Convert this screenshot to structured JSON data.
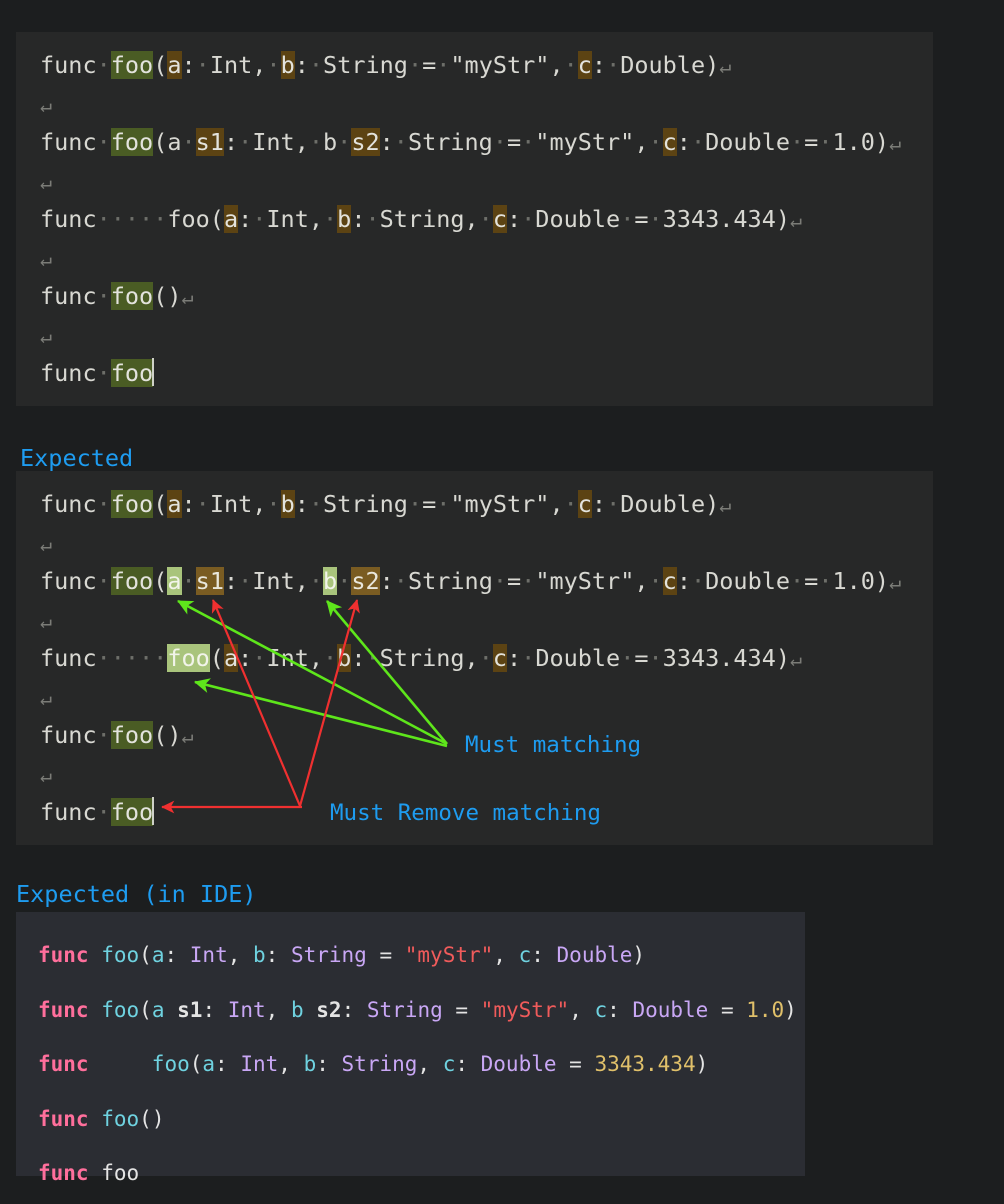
{
  "colors": {
    "page_bg": "#1c1e1f",
    "code_bg": "#272828",
    "ide_bg": "#2b2d33",
    "caption_blue": "#1e9cf0",
    "highlight_dark_green": "#4a5c24",
    "highlight_light_green": "#a9c47c",
    "highlight_dark_brown": "#5c4313",
    "highlight_light_brown": "#7a5c22",
    "arrow_green": "#5ee61b",
    "arrow_red": "#f03030",
    "keyword_pink": "#ff6f9c",
    "function_cyan": "#6fd2e0",
    "type_purple": "#c9a7f5",
    "string_red": "#f05b5b",
    "number_gold": "#e0c06a"
  },
  "block_actual": {
    "lines": [
      {
        "tokens": [
          {
            "t": "func",
            "s": "plain"
          },
          {
            "t": "·",
            "s": "ws"
          },
          {
            "t": "foo",
            "s": "hl-green"
          },
          {
            "t": "(",
            "s": "plain"
          },
          {
            "t": "a",
            "s": "hl-brown"
          },
          {
            "t": ":",
            "s": "plain"
          },
          {
            "t": "·",
            "s": "ws"
          },
          {
            "t": "Int,",
            "s": "plain"
          },
          {
            "t": "·",
            "s": "ws"
          },
          {
            "t": "b",
            "s": "hl-brown"
          },
          {
            "t": ":",
            "s": "plain"
          },
          {
            "t": "·",
            "s": "ws"
          },
          {
            "t": "String",
            "s": "plain"
          },
          {
            "t": "·",
            "s": "ws"
          },
          {
            "t": "=",
            "s": "plain"
          },
          {
            "t": "·",
            "s": "ws"
          },
          {
            "t": "\"myStr\",",
            "s": "plain"
          },
          {
            "t": "·",
            "s": "ws"
          },
          {
            "t": "c",
            "s": "hl-brown"
          },
          {
            "t": ":",
            "s": "plain"
          },
          {
            "t": "·",
            "s": "ws"
          },
          {
            "t": "Double)",
            "s": "plain"
          },
          {
            "t": "↵",
            "s": "cr"
          }
        ]
      },
      {
        "tokens": [
          {
            "t": "↵",
            "s": "cr"
          }
        ]
      },
      {
        "tokens": [
          {
            "t": "func",
            "s": "plain"
          },
          {
            "t": "·",
            "s": "ws"
          },
          {
            "t": "foo",
            "s": "hl-green"
          },
          {
            "t": "(a",
            "s": "plain"
          },
          {
            "t": "·",
            "s": "ws"
          },
          {
            "t": "s1",
            "s": "hl-brown"
          },
          {
            "t": ":",
            "s": "plain"
          },
          {
            "t": "·",
            "s": "ws"
          },
          {
            "t": "Int,",
            "s": "plain"
          },
          {
            "t": "·",
            "s": "ws"
          },
          {
            "t": "b",
            "s": "plain"
          },
          {
            "t": "·",
            "s": "ws"
          },
          {
            "t": "s2",
            "s": "hl-brown"
          },
          {
            "t": ":",
            "s": "plain"
          },
          {
            "t": "·",
            "s": "ws"
          },
          {
            "t": "String",
            "s": "plain"
          },
          {
            "t": "·",
            "s": "ws"
          },
          {
            "t": "=",
            "s": "plain"
          },
          {
            "t": "·",
            "s": "ws"
          },
          {
            "t": "\"myStr\",",
            "s": "plain"
          },
          {
            "t": "·",
            "s": "ws"
          },
          {
            "t": "c",
            "s": "hl-brown"
          },
          {
            "t": ":",
            "s": "plain"
          },
          {
            "t": "·",
            "s": "ws"
          },
          {
            "t": "Double",
            "s": "plain"
          },
          {
            "t": "·",
            "s": "ws"
          },
          {
            "t": "=",
            "s": "plain"
          },
          {
            "t": "·",
            "s": "ws"
          },
          {
            "t": "1.0)",
            "s": "plain"
          },
          {
            "t": "↵",
            "s": "cr"
          }
        ]
      },
      {
        "tokens": [
          {
            "t": "↵",
            "s": "cr"
          }
        ]
      },
      {
        "tokens": [
          {
            "t": "func",
            "s": "plain"
          },
          {
            "t": "·····",
            "s": "ws"
          },
          {
            "t": "foo(",
            "s": "plain"
          },
          {
            "t": "a",
            "s": "hl-brown"
          },
          {
            "t": ":",
            "s": "plain"
          },
          {
            "t": "·",
            "s": "ws"
          },
          {
            "t": "Int,",
            "s": "plain"
          },
          {
            "t": "·",
            "s": "ws"
          },
          {
            "t": "b",
            "s": "hl-brown"
          },
          {
            "t": ":",
            "s": "plain"
          },
          {
            "t": "·",
            "s": "ws"
          },
          {
            "t": "String,",
            "s": "plain"
          },
          {
            "t": "·",
            "s": "ws"
          },
          {
            "t": "c",
            "s": "hl-brown"
          },
          {
            "t": ":",
            "s": "plain"
          },
          {
            "t": "·",
            "s": "ws"
          },
          {
            "t": "Double",
            "s": "plain"
          },
          {
            "t": "·",
            "s": "ws"
          },
          {
            "t": "=",
            "s": "plain"
          },
          {
            "t": "·",
            "s": "ws"
          },
          {
            "t": "3343.434)",
            "s": "plain"
          },
          {
            "t": "↵",
            "s": "cr"
          }
        ]
      },
      {
        "tokens": [
          {
            "t": "↵",
            "s": "cr"
          }
        ]
      },
      {
        "tokens": [
          {
            "t": "func",
            "s": "plain"
          },
          {
            "t": "·",
            "s": "ws"
          },
          {
            "t": "foo",
            "s": "hl-green"
          },
          {
            "t": "()",
            "s": "plain"
          },
          {
            "t": "↵",
            "s": "cr"
          }
        ]
      },
      {
        "tokens": [
          {
            "t": "↵",
            "s": "cr"
          }
        ]
      },
      {
        "tokens": [
          {
            "t": "func",
            "s": "plain"
          },
          {
            "t": "·",
            "s": "ws"
          },
          {
            "t": "foo",
            "s": "hl-green"
          },
          {
            "t": "",
            "s": "caret"
          }
        ]
      }
    ]
  },
  "caption_expected": "Expected",
  "block_expected": {
    "lines": [
      {
        "tokens": [
          {
            "t": "func",
            "s": "plain"
          },
          {
            "t": "·",
            "s": "ws"
          },
          {
            "t": "foo",
            "s": "hl-green"
          },
          {
            "t": "(",
            "s": "plain"
          },
          {
            "t": "a",
            "s": "hl-brown"
          },
          {
            "t": ":",
            "s": "plain"
          },
          {
            "t": "·",
            "s": "ws"
          },
          {
            "t": "Int,",
            "s": "plain"
          },
          {
            "t": "·",
            "s": "ws"
          },
          {
            "t": "b",
            "s": "hl-brown"
          },
          {
            "t": ":",
            "s": "plain"
          },
          {
            "t": "·",
            "s": "ws"
          },
          {
            "t": "String",
            "s": "plain"
          },
          {
            "t": "·",
            "s": "ws"
          },
          {
            "t": "=",
            "s": "plain"
          },
          {
            "t": "·",
            "s": "ws"
          },
          {
            "t": "\"myStr\",",
            "s": "plain"
          },
          {
            "t": "·",
            "s": "ws"
          },
          {
            "t": "c",
            "s": "hl-brown"
          },
          {
            "t": ":",
            "s": "plain"
          },
          {
            "t": "·",
            "s": "ws"
          },
          {
            "t": "Double)",
            "s": "plain"
          },
          {
            "t": "↵",
            "s": "cr"
          }
        ]
      },
      {
        "tokens": [
          {
            "t": "↵",
            "s": "cr"
          }
        ]
      },
      {
        "tokens": [
          {
            "t": "func",
            "s": "plain"
          },
          {
            "t": "·",
            "s": "ws"
          },
          {
            "t": "foo",
            "s": "hl-green"
          },
          {
            "t": "(",
            "s": "plain"
          },
          {
            "t": "a",
            "s": "hl-lgreen"
          },
          {
            "t": "·",
            "s": "ws"
          },
          {
            "t": "s1",
            "s": "hl-lbrown"
          },
          {
            "t": ":",
            "s": "plain"
          },
          {
            "t": "·",
            "s": "ws"
          },
          {
            "t": "Int,",
            "s": "plain"
          },
          {
            "t": "·",
            "s": "ws"
          },
          {
            "t": "b",
            "s": "hl-lgreen"
          },
          {
            "t": "·",
            "s": "ws"
          },
          {
            "t": "s2",
            "s": "hl-lbrown"
          },
          {
            "t": ":",
            "s": "plain"
          },
          {
            "t": "·",
            "s": "ws"
          },
          {
            "t": "String",
            "s": "plain"
          },
          {
            "t": "·",
            "s": "ws"
          },
          {
            "t": "=",
            "s": "plain"
          },
          {
            "t": "·",
            "s": "ws"
          },
          {
            "t": "\"myStr\",",
            "s": "plain"
          },
          {
            "t": "·",
            "s": "ws"
          },
          {
            "t": "c",
            "s": "hl-brown"
          },
          {
            "t": ":",
            "s": "plain"
          },
          {
            "t": "·",
            "s": "ws"
          },
          {
            "t": "Double",
            "s": "plain"
          },
          {
            "t": "·",
            "s": "ws"
          },
          {
            "t": "=",
            "s": "plain"
          },
          {
            "t": "·",
            "s": "ws"
          },
          {
            "t": "1.0)",
            "s": "plain"
          },
          {
            "t": "↵",
            "s": "cr"
          }
        ]
      },
      {
        "tokens": [
          {
            "t": "↵",
            "s": "cr"
          }
        ]
      },
      {
        "tokens": [
          {
            "t": "func",
            "s": "plain"
          },
          {
            "t": "·····",
            "s": "ws"
          },
          {
            "t": "foo",
            "s": "hl-lgreen"
          },
          {
            "t": "(",
            "s": "plain"
          },
          {
            "t": "a",
            "s": "hl-brown"
          },
          {
            "t": ":",
            "s": "plain"
          },
          {
            "t": "·",
            "s": "ws"
          },
          {
            "t": "Int,",
            "s": "plain"
          },
          {
            "t": "·",
            "s": "ws"
          },
          {
            "t": "b",
            "s": "hl-brown"
          },
          {
            "t": ":",
            "s": "plain"
          },
          {
            "t": "·",
            "s": "ws"
          },
          {
            "t": "String,",
            "s": "plain"
          },
          {
            "t": "·",
            "s": "ws"
          },
          {
            "t": "c",
            "s": "hl-brown"
          },
          {
            "t": ":",
            "s": "plain"
          },
          {
            "t": "·",
            "s": "ws"
          },
          {
            "t": "Double",
            "s": "plain"
          },
          {
            "t": "·",
            "s": "ws"
          },
          {
            "t": "=",
            "s": "plain"
          },
          {
            "t": "·",
            "s": "ws"
          },
          {
            "t": "3343.434)",
            "s": "plain"
          },
          {
            "t": "↵",
            "s": "cr"
          }
        ]
      },
      {
        "tokens": [
          {
            "t": "↵",
            "s": "cr"
          }
        ]
      },
      {
        "tokens": [
          {
            "t": "func",
            "s": "plain"
          },
          {
            "t": "·",
            "s": "ws"
          },
          {
            "t": "foo",
            "s": "hl-green"
          },
          {
            "t": "()",
            "s": "plain"
          },
          {
            "t": "↵",
            "s": "cr"
          }
        ]
      },
      {
        "tokens": [
          {
            "t": "↵",
            "s": "cr"
          }
        ]
      },
      {
        "tokens": [
          {
            "t": "func",
            "s": "plain"
          },
          {
            "t": "·",
            "s": "ws"
          },
          {
            "t": "foo",
            "s": "hl-green"
          },
          {
            "t": "",
            "s": "caret"
          }
        ]
      }
    ]
  },
  "annotations": {
    "must_matching": "Must matching",
    "must_remove_matching": "Must Remove matching"
  },
  "caption_expected_ide": "Expected (in IDE)",
  "block_ide": {
    "lines": [
      {
        "tokens": [
          {
            "t": "func",
            "s": "kw"
          },
          {
            "t": " ",
            "s": "pln"
          },
          {
            "t": "foo",
            "s": "fn"
          },
          {
            "t": "(",
            "s": "op"
          },
          {
            "t": "a",
            "s": "lbl"
          },
          {
            "t": ": ",
            "s": "op"
          },
          {
            "t": "Int",
            "s": "typ"
          },
          {
            "t": ", ",
            "s": "op"
          },
          {
            "t": "b",
            "s": "lbl"
          },
          {
            "t": ": ",
            "s": "op"
          },
          {
            "t": "String",
            "s": "typ"
          },
          {
            "t": " = ",
            "s": "op"
          },
          {
            "t": "\"myStr\"",
            "s": "str"
          },
          {
            "t": ", ",
            "s": "op"
          },
          {
            "t": "c",
            "s": "lbl"
          },
          {
            "t": ": ",
            "s": "op"
          },
          {
            "t": "Double",
            "s": "typ"
          },
          {
            "t": ")",
            "s": "op"
          }
        ]
      },
      {
        "tokens": [
          {
            "t": "func",
            "s": "kw"
          },
          {
            "t": " ",
            "s": "pln"
          },
          {
            "t": "foo",
            "s": "fn"
          },
          {
            "t": "(",
            "s": "op"
          },
          {
            "t": "a",
            "s": "lbl"
          },
          {
            "t": " ",
            "s": "pln"
          },
          {
            "t": "s1",
            "s": "idn"
          },
          {
            "t": ": ",
            "s": "op"
          },
          {
            "t": "Int",
            "s": "typ"
          },
          {
            "t": ", ",
            "s": "op"
          },
          {
            "t": "b",
            "s": "lbl"
          },
          {
            "t": " ",
            "s": "pln"
          },
          {
            "t": "s2",
            "s": "idn"
          },
          {
            "t": ": ",
            "s": "op"
          },
          {
            "t": "String",
            "s": "typ"
          },
          {
            "t": " = ",
            "s": "op"
          },
          {
            "t": "\"myStr\"",
            "s": "str"
          },
          {
            "t": ", ",
            "s": "op"
          },
          {
            "t": "c",
            "s": "lbl"
          },
          {
            "t": ": ",
            "s": "op"
          },
          {
            "t": "Double",
            "s": "typ"
          },
          {
            "t": " = ",
            "s": "op"
          },
          {
            "t": "1.0",
            "s": "num"
          },
          {
            "t": ")",
            "s": "op"
          }
        ]
      },
      {
        "tokens": [
          {
            "t": "func",
            "s": "kw"
          },
          {
            "t": "     ",
            "s": "pln"
          },
          {
            "t": "foo",
            "s": "fn"
          },
          {
            "t": "(",
            "s": "op"
          },
          {
            "t": "a",
            "s": "lbl"
          },
          {
            "t": ": ",
            "s": "op"
          },
          {
            "t": "Int",
            "s": "typ"
          },
          {
            "t": ", ",
            "s": "op"
          },
          {
            "t": "b",
            "s": "lbl"
          },
          {
            "t": ": ",
            "s": "op"
          },
          {
            "t": "String",
            "s": "typ"
          },
          {
            "t": ", ",
            "s": "op"
          },
          {
            "t": "c",
            "s": "lbl"
          },
          {
            "t": ": ",
            "s": "op"
          },
          {
            "t": "Double",
            "s": "typ"
          },
          {
            "t": " = ",
            "s": "op"
          },
          {
            "t": "3343.434",
            "s": "num"
          },
          {
            "t": ")",
            "s": "op"
          }
        ]
      },
      {
        "tokens": [
          {
            "t": "func",
            "s": "kw"
          },
          {
            "t": " ",
            "s": "pln"
          },
          {
            "t": "foo",
            "s": "fn"
          },
          {
            "t": "()",
            "s": "op"
          }
        ]
      },
      {
        "tokens": [
          {
            "t": "func",
            "s": "kw"
          },
          {
            "t": " ",
            "s": "pln"
          },
          {
            "t": "foo",
            "s": "pln"
          }
        ]
      }
    ]
  }
}
